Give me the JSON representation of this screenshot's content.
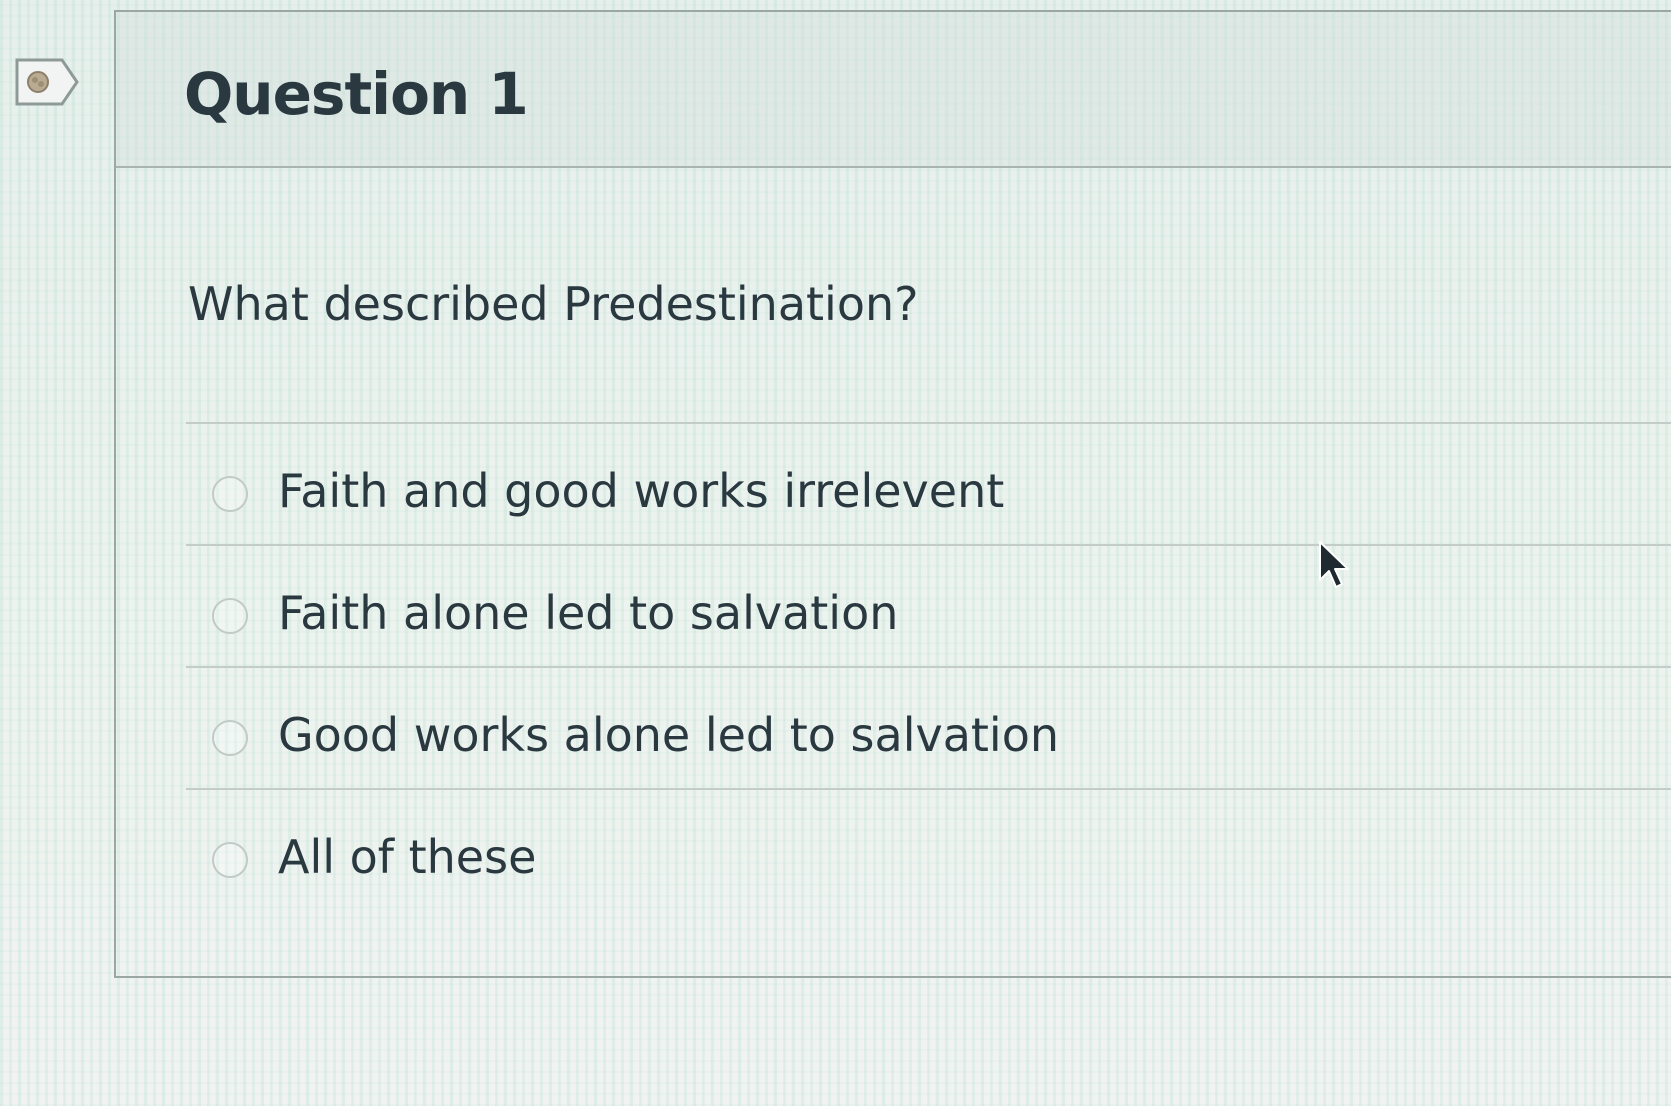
{
  "question": {
    "title": "Question 1",
    "text": "What described Predestination?",
    "answers": [
      {
        "label": "Faith and good works irrelevent",
        "selected": false
      },
      {
        "label": "Faith alone led to salvation",
        "selected": false
      },
      {
        "label": "Good works alone led to salvation",
        "selected": false
      },
      {
        "label": "All of these",
        "selected": false
      }
    ]
  },
  "icons": {
    "flag": "flag-question-icon",
    "cursor": "mouse-pointer-icon"
  },
  "colors": {
    "text": "#2a3840",
    "border": "#9aa7a3",
    "radio_border": "#c2cac7"
  }
}
